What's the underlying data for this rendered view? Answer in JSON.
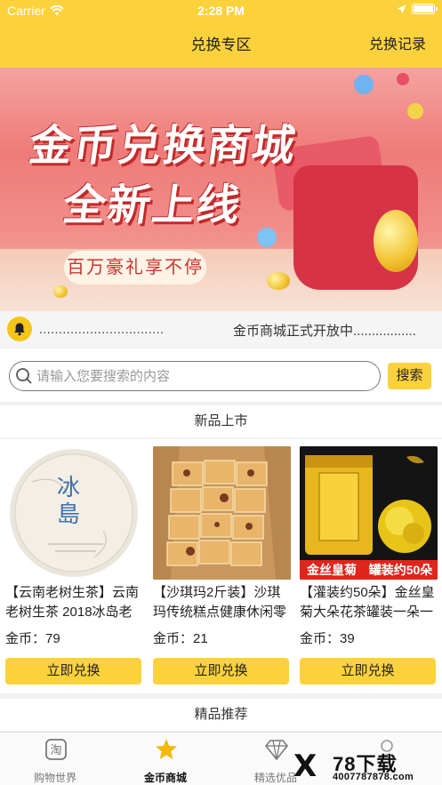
{
  "status_bar": {
    "carrier": "Carrier",
    "time": "2:28 PM"
  },
  "nav": {
    "title": "兑换专区",
    "right_action": "兑换记录"
  },
  "banner": {
    "line1": "金币兑换商城",
    "line2": "全新上线",
    "tagline": "百万豪礼享不停"
  },
  "notice": {
    "dots": "................................",
    "text": "金币商城正式开放中................."
  },
  "search": {
    "placeholder": "请输入您要搜索的内容",
    "button": "搜索"
  },
  "sections": {
    "new": "新品上市",
    "featured": "精品推荐"
  },
  "products": [
    {
      "name": "【云南老树生茶】云南老树生茶 2018冰岛老",
      "price": "金币：79",
      "button": "立即兑换",
      "thumb_text": "冰島"
    },
    {
      "name": "【沙琪玛2斤装】沙琪玛传统糕点健康休闲零",
      "price": "金币：21",
      "button": "立即兑换"
    },
    {
      "name": "【灌装约50朵】金丝皇菊大朵花茶罐装一朵一",
      "price": "金币：39",
      "button": "立即兑换",
      "thumb_text": "金丝皇菊",
      "thumb_badge": "罐装约50朵"
    }
  ],
  "tabbar": [
    {
      "label": "购物世界",
      "icon": "shopping-icon",
      "active": false
    },
    {
      "label": "金币商城",
      "icon": "star-icon",
      "active": true
    },
    {
      "label": "精选优品",
      "icon": "diamond-icon",
      "active": false
    },
    {
      "label": "",
      "icon": "user-icon",
      "active": false
    }
  ],
  "watermark": {
    "brand": "78下载",
    "phone": "4007787878.com"
  },
  "colors": {
    "accent": "#fcd23c",
    "banner_red": "#ee7b79"
  }
}
